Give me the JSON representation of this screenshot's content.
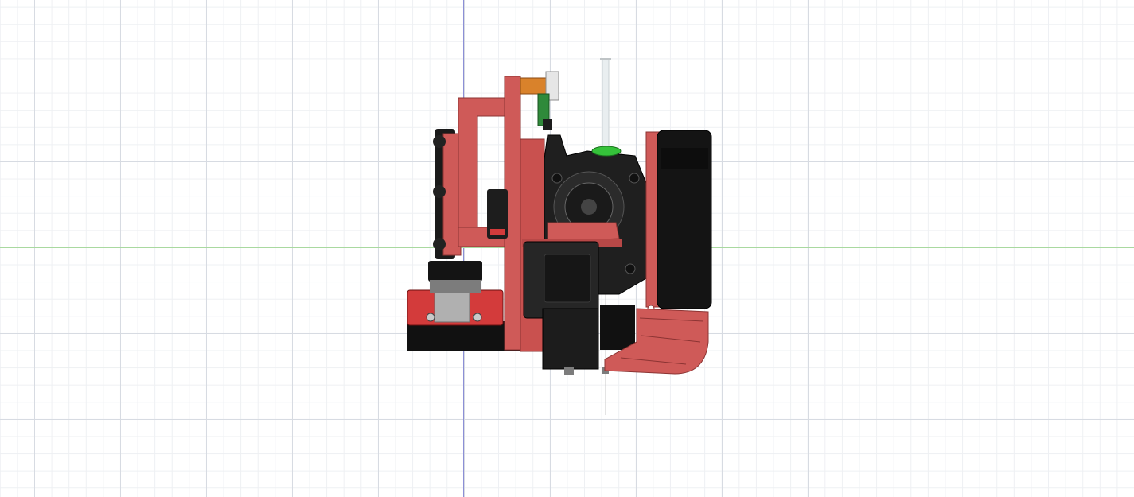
{
  "viewport": {
    "background_color": "#ffffff",
    "grid_major_color": "#d7dbe2",
    "grid_minor_color": "#eef0f3"
  },
  "axes": {
    "vertical_axis_color": "#8c8fd6",
    "horizontal_axis_color": "#a9d9a0"
  },
  "model": {
    "part_colors": {
      "printed_red": "#cf5a58",
      "printed_red_dark": "#a8403f",
      "motor_black": "#1c1c1c",
      "motor_gray": "#3a3a3a",
      "pcb_green": "#2f8a3a",
      "connector_orange": "#d9822b",
      "fitting_green": "#35c23a",
      "rail_black": "#111111",
      "carriage_red": "#d33b3b",
      "metal_gray": "#b9b9b9"
    }
  }
}
